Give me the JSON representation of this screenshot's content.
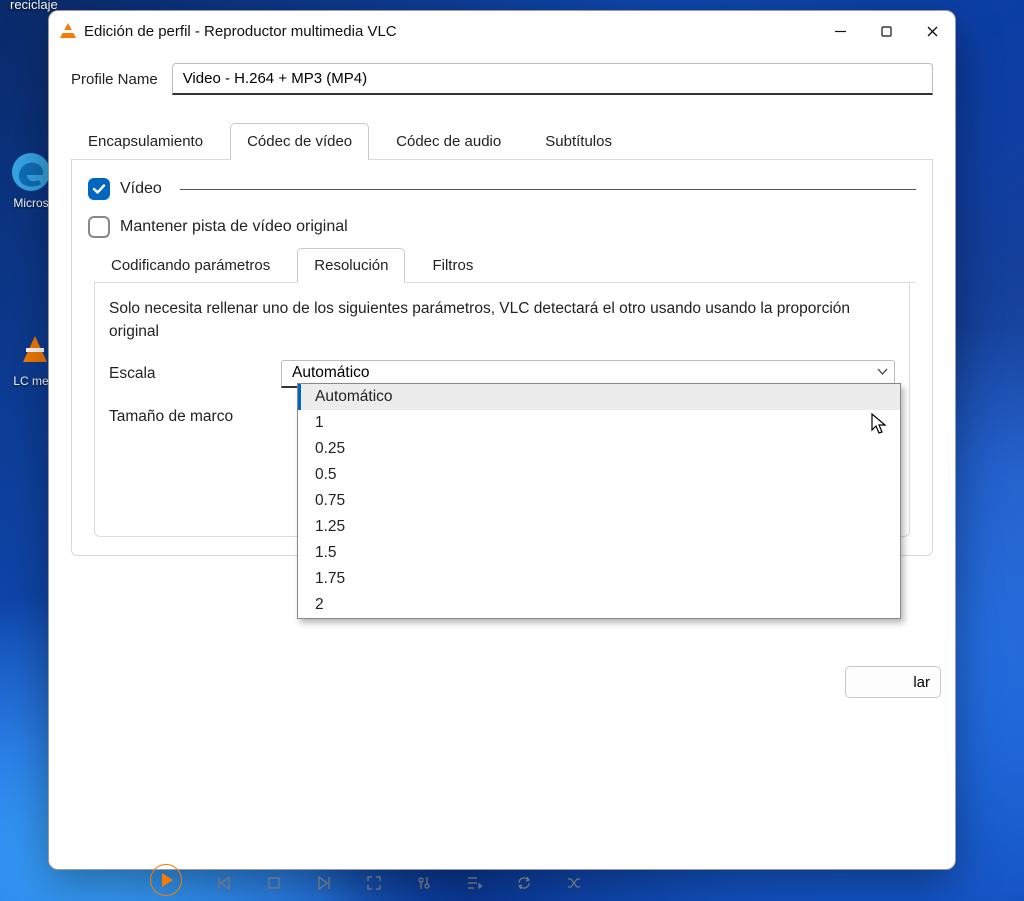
{
  "desktop": {
    "recycle_label": "reciclaje",
    "edge_label": "Micros",
    "vlc_label": "LC me"
  },
  "dialog": {
    "title": "Edición de perfil - Reproductor multimedia VLC",
    "profile_name_label": "Profile Name",
    "profile_name_value": "Video - H.264 + MP3 (MP4)",
    "tabs": {
      "encapsulation": "Encapsulamiento",
      "video_codec": "Códec de vídeo",
      "audio_codec": "Códec de audio",
      "subtitles": "Subtítulos"
    },
    "video_checkbox_label": "Vídeo",
    "keep_original_label": "Mantener pista de vídeo original",
    "subtabs": {
      "encoding": "Codificando parámetros",
      "resolution": "Resolución",
      "filters": "Filtros"
    },
    "resolution_hint": "Solo necesita rellenar uno de los siguientes parámetros, VLC detectará el otro usando usando la proporción original",
    "scale_label": "Escala",
    "scale_value": "Automático",
    "framesize_label": "Tamaño de marco",
    "scale_options": [
      "Automático",
      "1",
      "0.25",
      "0.5",
      "0.75",
      "1.25",
      "1.5",
      "1.75",
      "2"
    ],
    "cancel_partial": "lar"
  }
}
